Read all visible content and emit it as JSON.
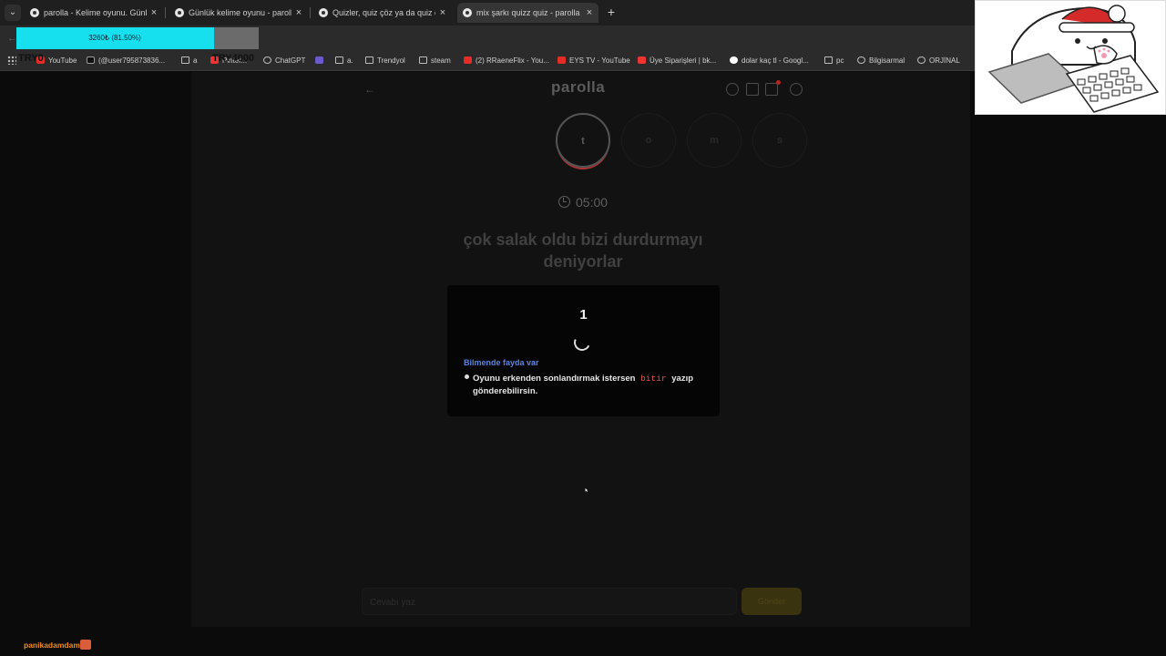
{
  "browser": {
    "tabs": [
      {
        "title": "parolla - Kelime oyunu. Günlük",
        "active": false
      },
      {
        "title": "Günlük kelime oyunu - parolla",
        "active": false
      },
      {
        "title": "Quizler, quiz çöz ya da quiz olu",
        "active": false
      },
      {
        "title": "mix şarkı quizz quiz - parolla - I",
        "active": true
      }
    ],
    "tab_close": "×",
    "new_tab": "+",
    "window_controls": [
      "—",
      "❐",
      "✕"
    ],
    "bookmarks": [
      {
        "label": "YouTube",
        "icon": "youtube-icon"
      },
      {
        "label": "(@user795873836...",
        "icon": "tiktok-icon"
      },
      {
        "label": "a",
        "icon": "folder-icon"
      },
      {
        "label": "Pinter...",
        "icon": "pinterest-icon"
      },
      {
        "label": "ChatGPT",
        "icon": "chatgpt-icon"
      },
      {
        "label": "a.",
        "icon": "folder-icon"
      },
      {
        "label": "Trendyol",
        "icon": "folder-icon"
      },
      {
        "label": "steam",
        "icon": "folder-icon"
      },
      {
        "label": "(2) RRaeneFlix - You...",
        "icon": "youtube-icon"
      },
      {
        "label": "EYS TV - YouTube",
        "icon": "youtube-icon"
      },
      {
        "label": "Üye Siparişleri | bk...",
        "icon": "store-icon"
      },
      {
        "label": "dolar kaç tl - Googl...",
        "icon": "google-icon"
      },
      {
        "label": "pc",
        "icon": "folder-icon"
      },
      {
        "label": "Bilgisarmal",
        "icon": "globe-icon"
      },
      {
        "label": "ORJİNAL",
        "icon": "globe-icon"
      }
    ],
    "bookmarks_more": "»"
  },
  "stream_overlay": {
    "donation_progress_text": "3260₺ (81.50%)",
    "donation_progress": 0.815,
    "goal_start": "TRY0",
    "goal_end": "TRY4000",
    "streamer_name": "panikadamdam"
  },
  "page": {
    "logo": "parolla",
    "letters": [
      "t",
      "o",
      "m",
      "s"
    ],
    "timer": "05:00",
    "question": "çok salak oldu bizi durdurmayı deniyorlar",
    "modal": {
      "countdown": "1",
      "tip_title": "Bilmende fayda var",
      "tip_before": "Oyunu erkenden sonlandırmak istersen",
      "tip_code": "bitir",
      "tip_after": "yazıp gönderebilirsin."
    },
    "answer_placeholder": "Cevabı yaz",
    "send_label": "Gönder"
  },
  "colors": {
    "progress_fill": "#16e0ee",
    "tip_title": "#5a84e0",
    "code": "#e0564b",
    "streamer": "#f08a20"
  }
}
